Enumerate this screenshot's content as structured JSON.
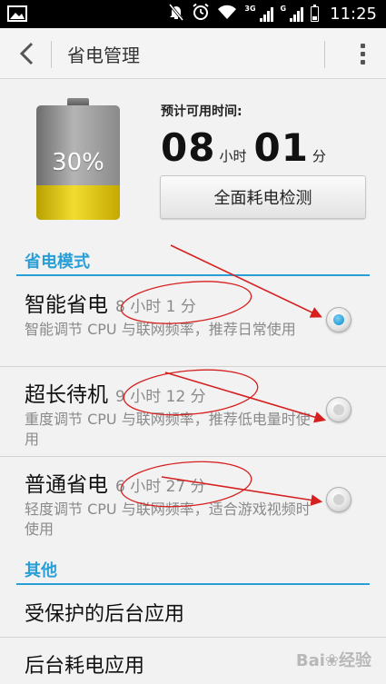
{
  "status_bar": {
    "time": "11:25",
    "net1": "3G",
    "net2": "G"
  },
  "action_bar": {
    "title": "省电管理"
  },
  "battery": {
    "percent_text": "30%",
    "level": 0.3,
    "estimate_label": "预计可用时间:",
    "hours": "08",
    "hours_unit": "小时",
    "minutes": "01",
    "minutes_unit": "分",
    "check_button": "全面耗电检测"
  },
  "power_modes": {
    "header": "省电模式",
    "items": [
      {
        "name": "智能省电",
        "time": "8 小时 1 分",
        "desc": "智能调节 CPU 与联网频率，推荐日常使用",
        "selected": true
      },
      {
        "name": "超长待机",
        "time": "9 小时 12 分",
        "desc": "重度调节 CPU 与联网频率，推荐低电量时使用",
        "selected": false
      },
      {
        "name": "普通省电",
        "time": "6 小时 27 分",
        "desc": "轻度调节 CPU 与联网频率，适合游戏视频时使用",
        "selected": false
      }
    ]
  },
  "other": {
    "header": "其他",
    "items": [
      {
        "label": "受保护的后台应用"
      },
      {
        "label": "后台耗电应用"
      }
    ]
  },
  "colors": {
    "accent": "#2a9fd6",
    "annotation": "#d62020",
    "battery_fill": "#e8cf20"
  }
}
